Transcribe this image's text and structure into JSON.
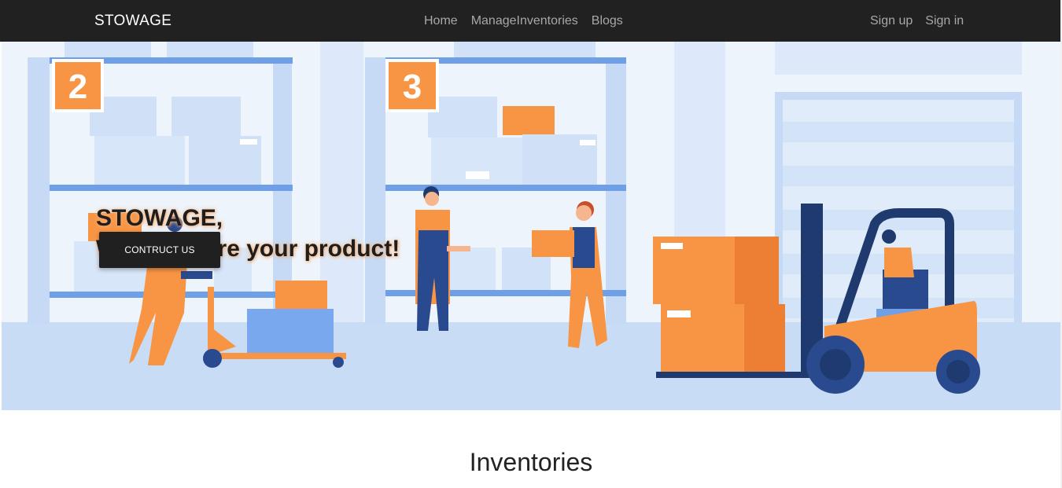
{
  "navbar": {
    "brand": "STOWAGE",
    "links": [
      "Home",
      "ManageInventories",
      "Blogs"
    ],
    "auth": [
      "Sign up",
      "Sign in"
    ]
  },
  "hero": {
    "title_line1": "STOWAGE,",
    "title_line2": "We take care your product!",
    "cta_label": "CONTRUCT US",
    "shelf_numbers": [
      "2",
      "3"
    ],
    "colors": {
      "accent": "#f79545",
      "dark_blue": "#1e3a6e",
      "light_blue": "#c7dcf7",
      "navbar": "#212121"
    }
  },
  "section": {
    "title": "Inventories"
  }
}
